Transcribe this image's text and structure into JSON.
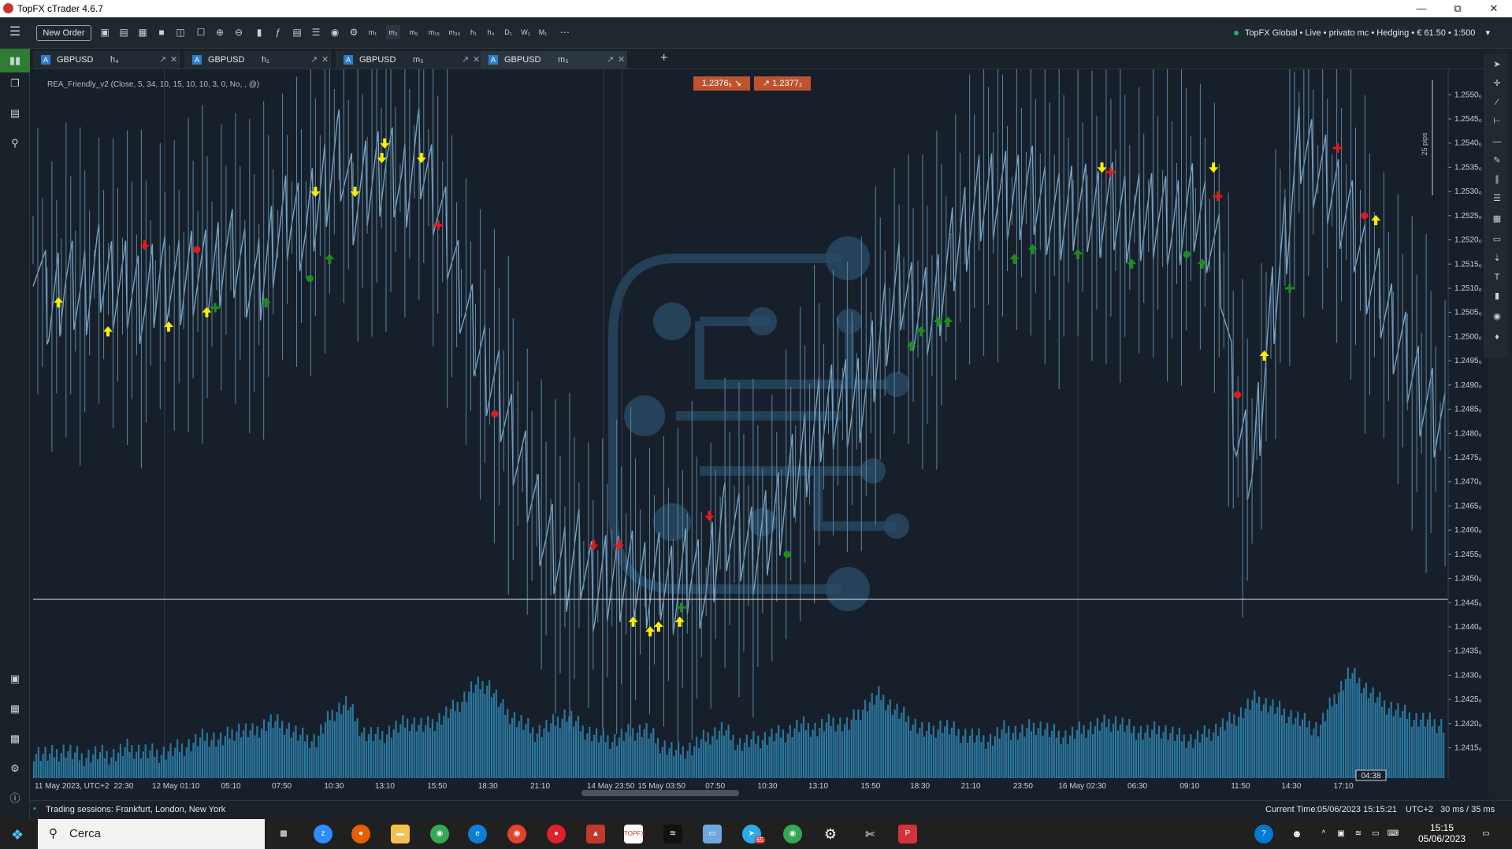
{
  "window": {
    "title": "TopFX cTrader 4.6.7"
  },
  "toolbar": {
    "new_order": "New Order",
    "timeframes": [
      "m₁",
      "m₃",
      "m₅",
      "m₁₅",
      "m₃₀",
      "h₁",
      "h₄",
      "D₁",
      "W₁",
      "M₁"
    ],
    "account": "TopFX Global • Live • privato mc • Hedging • € 61.50 • 1:500"
  },
  "tabs": [
    {
      "badge": "A",
      "symbol": "GBPUSD",
      "timeframe": "h₄"
    },
    {
      "badge": "A",
      "symbol": "GBPUSD",
      "timeframe": "h₁"
    },
    {
      "badge": "A",
      "symbol": "GBPUSD",
      "timeframe": "m₅"
    },
    {
      "badge": "A",
      "symbol": "GBPUSD",
      "timeframe": "m₅"
    }
  ],
  "chart_data": {
    "type": "line",
    "symbol": "GBPUSD",
    "indicator": "REA_Friendly_v2 (Close, 5, 34, 10, 15, 10, 10, 3, 0, No, , @)",
    "bid": "1.2376₅",
    "ask": "1.2377₂",
    "range_label": "25 pips",
    "y_ticks": [
      "1.2550₀",
      "1.2545₀",
      "1.2540₀",
      "1.2535₀",
      "1.2530₀",
      "1.2525₀",
      "1.2520₀",
      "1.2515₀",
      "1.2510₀",
      "1.2505₀",
      "1.2500₀",
      "1.2495₀",
      "1.2490₀",
      "1.2485₀",
      "1.2480₀",
      "1.2475₀",
      "1.2470₀",
      "1.2465₀",
      "1.2460₀",
      "1.2455₀",
      "1.2450₀",
      "1.2445₀",
      "1.2440₀",
      "1.2435₀",
      "1.2430₀",
      "1.2425₀",
      "1.2420₀",
      "1.2415₀"
    ],
    "x_ticks": [
      "11 May 2023, UTC+2",
      "22:30",
      "12 May 01:10",
      "05:10",
      "07:50",
      "10:30",
      "13:10",
      "15:50",
      "18:30",
      "21:10",
      "14 May 23:50",
      "15 May 03:50",
      "07:50",
      "10:30",
      "13:10",
      "15:50",
      "18:30",
      "21:10",
      "23:50",
      "16 May 02:30",
      "06:30",
      "09:10",
      "11:50",
      "14:30",
      "17:10"
    ],
    "crosshair_time": "04:38",
    "ylim": [
      1.2412,
      1.2552
    ],
    "price_points": [
      1.252,
      1.2505,
      1.2512,
      1.2508,
      1.2514,
      1.2511,
      1.251,
      1.2507,
      1.2513,
      1.251,
      1.2514,
      1.2512,
      1.2518,
      1.2515,
      1.251,
      1.252,
      1.2525,
      1.2522,
      1.253,
      1.2538,
      1.2528,
      1.2532,
      1.2536,
      1.253,
      1.2538,
      1.253,
      1.2518,
      1.2505,
      1.2495,
      1.2488,
      1.2478,
      1.2468,
      1.2458,
      1.2452,
      1.2455,
      1.2448,
      1.245,
      1.2451,
      1.2449,
      1.245,
      1.2448,
      1.2452,
      1.2447,
      1.2462,
      1.2458,
      1.2456,
      1.246,
      1.2468,
      1.2475,
      1.2482,
      1.2487,
      1.2485,
      1.249,
      1.2502,
      1.251,
      1.2506,
      1.2504,
      1.2515,
      1.2522,
      1.2528,
      1.253,
      1.2528,
      1.2531,
      1.2527,
      1.2524,
      1.2528,
      1.2525,
      1.2527,
      1.2525,
      1.2524,
      1.2526,
      1.2522,
      1.2527,
      1.2524,
      1.2515,
      1.248,
      1.2472,
      1.25,
      1.252,
      1.254,
      1.2535,
      1.253,
      1.2525,
      1.2515,
      1.2508,
      1.25,
      1.2492,
      1.2485,
      1.248
    ],
    "volume_points": [
      14,
      12,
      15,
      11,
      13,
      12,
      16,
      14,
      13,
      15,
      18,
      22,
      20,
      26,
      24,
      30,
      28,
      22,
      20,
      34,
      40,
      24,
      22,
      26,
      30,
      27,
      32,
      38,
      48,
      50,
      36,
      30,
      24,
      28,
      34,
      26,
      22,
      20,
      24,
      26,
      18,
      14,
      16,
      22,
      26,
      18,
      20,
      22,
      24,
      28,
      26,
      30,
      28,
      38,
      44,
      36,
      30,
      24,
      28,
      24,
      22,
      20,
      26,
      24,
      28,
      24,
      22,
      26,
      28,
      30,
      26,
      24,
      26,
      22,
      20,
      24,
      28,
      34,
      42,
      38,
      34,
      30,
      26,
      42,
      56,
      48,
      40,
      36,
      32,
      30,
      28
    ],
    "signals": [
      {
        "kind": "yellow-up",
        "x": 0.018,
        "y": 1.2507
      },
      {
        "kind": "yellow-up",
        "x": 0.053,
        "y": 1.2501
      },
      {
        "kind": "red-down",
        "x": 0.079,
        "y": 1.2519
      },
      {
        "kind": "yellow-up",
        "x": 0.096,
        "y": 1.2502
      },
      {
        "kind": "red-dot",
        "x": 0.116,
        "y": 1.2518
      },
      {
        "kind": "yellow-up",
        "x": 0.123,
        "y": 1.2505
      },
      {
        "kind": "green-plus",
        "x": 0.129,
        "y": 1.2506
      },
      {
        "kind": "green-up",
        "x": 0.165,
        "y": 1.2507
      },
      {
        "kind": "green-dot",
        "x": 0.196,
        "y": 1.2512
      },
      {
        "kind": "yellow-down",
        "x": 0.2,
        "y": 1.253
      },
      {
        "kind": "green-up",
        "x": 0.21,
        "y": 1.2516
      },
      {
        "kind": "yellow-down",
        "x": 0.228,
        "y": 1.253
      },
      {
        "kind": "yellow-down",
        "x": 0.247,
        "y": 1.2537
      },
      {
        "kind": "yellow-down",
        "x": 0.249,
        "y": 1.254
      },
      {
        "kind": "yellow-down",
        "x": 0.275,
        "y": 1.2537
      },
      {
        "kind": "red-plus",
        "x": 0.287,
        "y": 1.2523
      },
      {
        "kind": "red-dot",
        "x": 0.327,
        "y": 1.2484
      },
      {
        "kind": "red-down",
        "x": 0.397,
        "y": 1.2457
      },
      {
        "kind": "red-down",
        "x": 0.415,
        "y": 1.2457
      },
      {
        "kind": "yellow-up",
        "x": 0.425,
        "y": 1.2441
      },
      {
        "kind": "yellow-up",
        "x": 0.437,
        "y": 1.2439
      },
      {
        "kind": "yellow-up",
        "x": 0.443,
        "y": 1.244
      },
      {
        "kind": "yellow-up",
        "x": 0.458,
        "y": 1.2441
      },
      {
        "kind": "green-plus",
        "x": 0.459,
        "y": 1.2444
      },
      {
        "kind": "red-down",
        "x": 0.479,
        "y": 1.2463
      },
      {
        "kind": "green-dot",
        "x": 0.534,
        "y": 1.2455
      },
      {
        "kind": "green-up",
        "x": 0.622,
        "y": 1.2498
      },
      {
        "kind": "green-up",
        "x": 0.629,
        "y": 1.2501
      },
      {
        "kind": "green-up",
        "x": 0.641,
        "y": 1.2503
      },
      {
        "kind": "green-up",
        "x": 0.648,
        "y": 1.2503
      },
      {
        "kind": "green-up",
        "x": 0.695,
        "y": 1.2516
      },
      {
        "kind": "green-up",
        "x": 0.708,
        "y": 1.2518
      },
      {
        "kind": "green-up",
        "x": 0.74,
        "y": 1.2517
      },
      {
        "kind": "yellow-down",
        "x": 0.757,
        "y": 1.2535
      },
      {
        "kind": "red-plus",
        "x": 0.763,
        "y": 1.2534
      },
      {
        "kind": "green-up",
        "x": 0.778,
        "y": 1.2515
      },
      {
        "kind": "green-dot",
        "x": 0.817,
        "y": 1.2517
      },
      {
        "kind": "green-up",
        "x": 0.828,
        "y": 1.2515
      },
      {
        "kind": "yellow-down",
        "x": 0.836,
        "y": 1.2535
      },
      {
        "kind": "red-plus",
        "x": 0.839,
        "y": 1.2529
      },
      {
        "kind": "red-dot",
        "x": 0.853,
        "y": 1.2488
      },
      {
        "kind": "yellow-up",
        "x": 0.872,
        "y": 1.2496
      },
      {
        "kind": "green-plus",
        "x": 0.89,
        "y": 1.251
      },
      {
        "kind": "red-plus",
        "x": 0.924,
        "y": 1.2539
      },
      {
        "kind": "red-dot",
        "x": 0.943,
        "y": 1.2525
      },
      {
        "kind": "yellow-up",
        "x": 0.951,
        "y": 1.2524
      }
    ]
  },
  "statusbar": {
    "sessions": "Trading sessions: Frankfurt, London, New York",
    "current_time_label": "Current Time:",
    "current_time": "05/06/2023 15:15:21",
    "timezone": "UTC+2",
    "latency": "30 ms / 35 ms"
  },
  "taskbar": {
    "search": "Cerca",
    "time": "15:15",
    "date": "05/06/2023",
    "badge": "65"
  }
}
